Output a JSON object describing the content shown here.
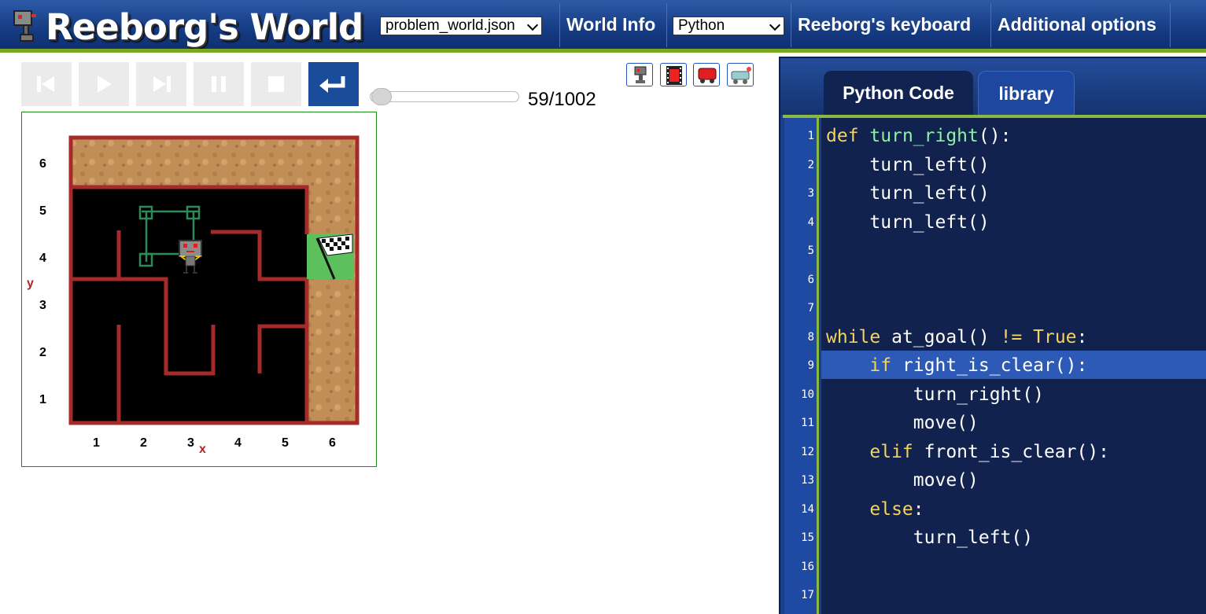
{
  "header": {
    "title": "Reeborg's World",
    "world_select_value": "problem_world.json",
    "world_info_label": "World Info",
    "language_select_value": "Python",
    "keyboard_label": "Reeborg's keyboard",
    "options_label": "Additional options"
  },
  "controls": {
    "buttons": [
      "reverse-step",
      "run",
      "step",
      "pause",
      "stop",
      "reload"
    ],
    "step_counter": "59/1002",
    "slider_value_fraction": 0.05
  },
  "world": {
    "y_labels": [
      "6",
      "5",
      "4",
      "3",
      "2",
      "1"
    ],
    "x_labels": [
      "1",
      "2",
      "3",
      "4",
      "5",
      "6"
    ],
    "x_axis_name": "x",
    "y_axis_name": "y",
    "colors": {
      "wall": "#a52a2a",
      "floor": "#000000",
      "sand": "#c8935a",
      "goal": "#5cc15c",
      "trail": "#2e8b57"
    }
  },
  "editor": {
    "tabs": [
      "Python Code",
      "library"
    ],
    "active_tab": "Python Code",
    "highlighted_line": 9,
    "line_numbers": [
      "1",
      "2",
      "3",
      "4",
      "5",
      "6",
      "7",
      "8",
      "9",
      "10",
      "11",
      "12",
      "13",
      "14",
      "15",
      "16",
      "17"
    ],
    "lines": [
      [
        {
          "t": "def",
          "c": "kw"
        },
        {
          "t": " "
        },
        {
          "t": "turn_right",
          "c": "fn"
        },
        {
          "t": "():"
        }
      ],
      [
        {
          "t": "    turn_left()"
        }
      ],
      [
        {
          "t": "    turn_left()"
        }
      ],
      [
        {
          "t": "    turn_left()"
        }
      ],
      [],
      [],
      [],
      [
        {
          "t": "while",
          "c": "kw"
        },
        {
          "t": " at_goal() "
        },
        {
          "t": "!=",
          "c": "kw"
        },
        {
          "t": " "
        },
        {
          "t": "True",
          "c": "kw"
        },
        {
          "t": ":"
        }
      ],
      [
        {
          "t": "    "
        },
        {
          "t": "if",
          "c": "kw"
        },
        {
          "t": " right_is_clear():"
        }
      ],
      [
        {
          "t": "        turn_right()"
        }
      ],
      [
        {
          "t": "        move()"
        }
      ],
      [
        {
          "t": "    "
        },
        {
          "t": "elif",
          "c": "kw"
        },
        {
          "t": " front_is_clear():"
        }
      ],
      [
        {
          "t": "        move()"
        }
      ],
      [
        {
          "t": "    "
        },
        {
          "t": "else",
          "c": "kw"
        },
        {
          "t": ":"
        }
      ],
      [
        {
          "t": "        turn_left()"
        }
      ],
      [],
      []
    ]
  }
}
